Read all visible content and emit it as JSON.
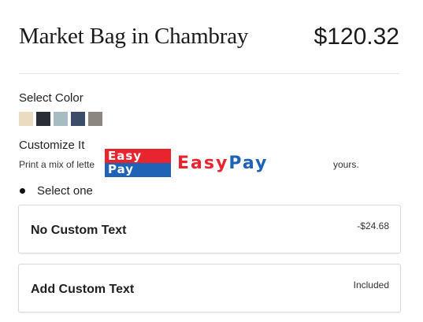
{
  "product": {
    "title": "Market Bag in Chambray",
    "price": "$120.32"
  },
  "color": {
    "label": "Select Color",
    "swatches": [
      {
        "name": "natural",
        "hex": "#eadcc0"
      },
      {
        "name": "charcoal",
        "hex": "#2a2f36"
      },
      {
        "name": "sky",
        "hex": "#a7bcc0"
      },
      {
        "name": "chambray-navy",
        "hex": "#3a4e6a"
      },
      {
        "name": "grey-linen",
        "hex": "#8b867f"
      }
    ]
  },
  "customize": {
    "label": "Customize It",
    "note_start": "Print a mix of lette",
    "note_end": "yours."
  },
  "easypay": {
    "box_line1": "Easy",
    "box_line2": "Pay",
    "word_easy": "Easy",
    "word_pay": "Pay",
    "red": "#e8252f",
    "blue": "#1e63b6"
  },
  "options": {
    "header": "Select one",
    "items": [
      {
        "label": "No Custom Text",
        "price": "-$24.68"
      },
      {
        "label": "Add Custom Text",
        "price": "Included"
      }
    ]
  }
}
